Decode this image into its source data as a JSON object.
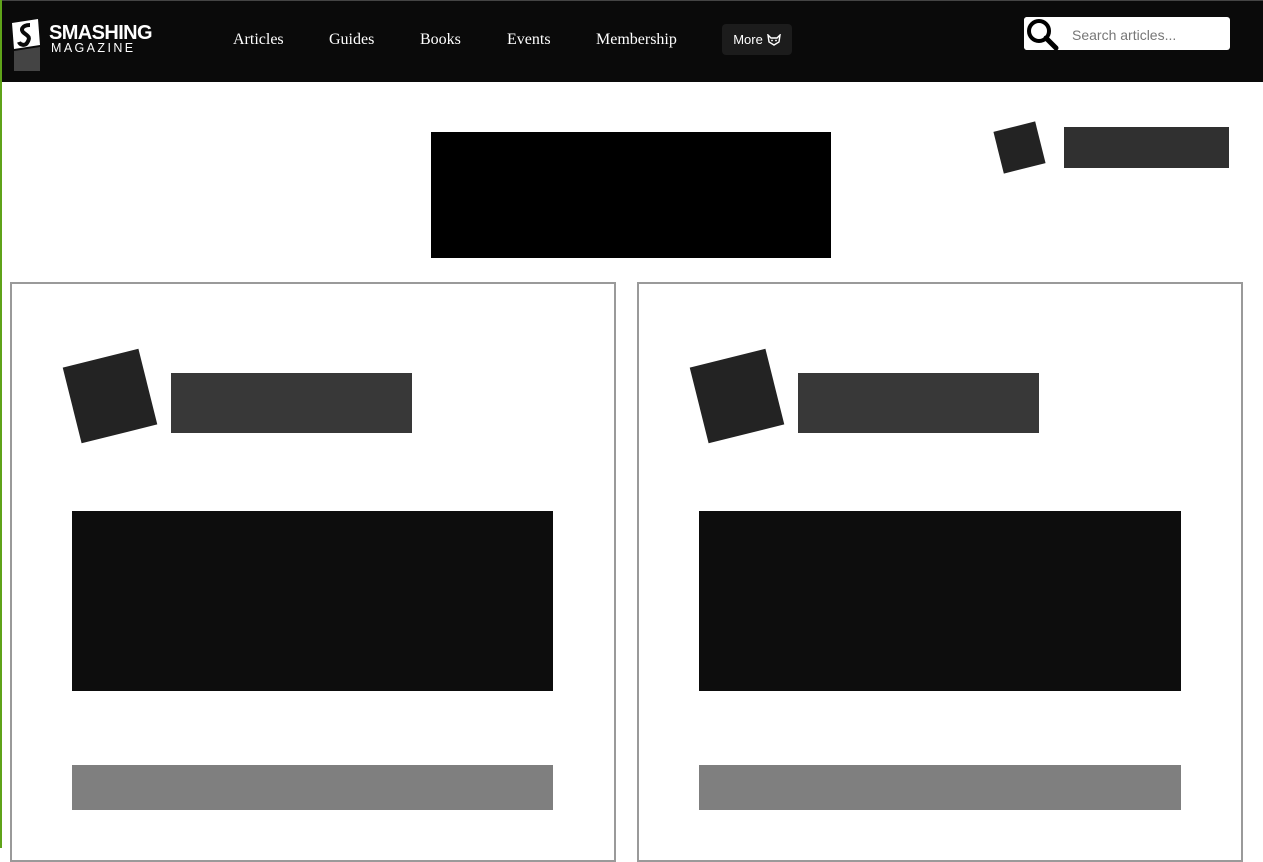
{
  "brand": {
    "name_line1": "SMASHING",
    "name_line2": "MAGAZINE"
  },
  "nav": {
    "items": [
      {
        "label": "Articles"
      },
      {
        "label": "Guides"
      },
      {
        "label": "Books"
      },
      {
        "label": "Events"
      },
      {
        "label": "Membership"
      }
    ],
    "more_label": "More"
  },
  "search": {
    "placeholder": "Search articles...",
    "value": ""
  },
  "colors": {
    "header_bg": "#0a0a0a",
    "accent": "#5fa319",
    "card_border": "#9a9a9a"
  },
  "icons": {
    "logo": "smashing-logo-icon",
    "more": "cat-icon",
    "search": "search-icon"
  }
}
